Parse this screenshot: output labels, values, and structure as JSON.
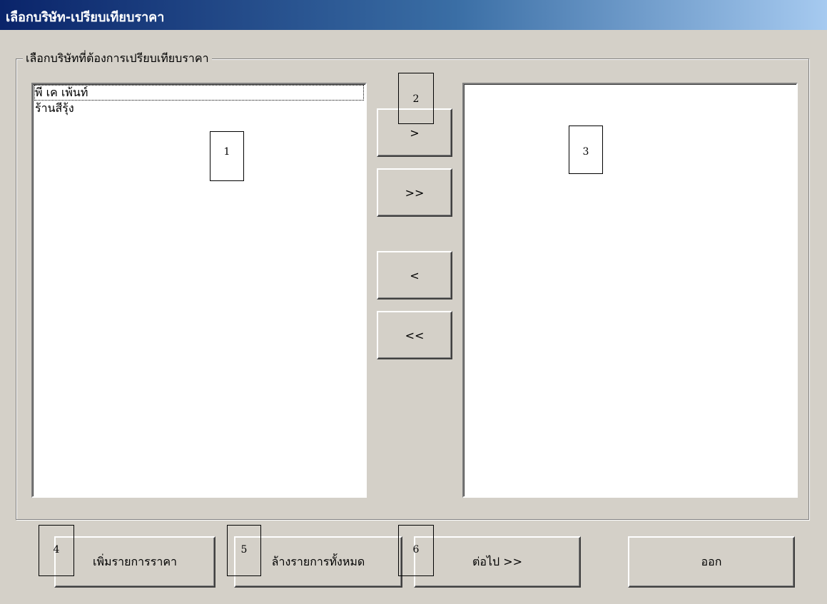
{
  "window": {
    "title": "เลือกบริษัท-เปรียบเทียบราคา"
  },
  "group": {
    "legend": "เลือกบริษัทที่ต้องการเปรียบเทียบราคา"
  },
  "left_list": {
    "items": [
      "พี เค เพ้นท์",
      "ร้านสีรุ้ง"
    ]
  },
  "right_list": {
    "items": []
  },
  "transfer_buttons": {
    "add_one": ">",
    "add_all": ">>",
    "remove_one": "<",
    "remove_all": "<<"
  },
  "bottom_buttons": {
    "add_price": "เพิ่มรายการราคา",
    "clear_all": "ล้างรายการทั้งหมด",
    "next": "ต่อไป >>",
    "exit": "ออก"
  },
  "annotations": [
    "1",
    "2",
    "3",
    "4",
    "5",
    "6"
  ]
}
